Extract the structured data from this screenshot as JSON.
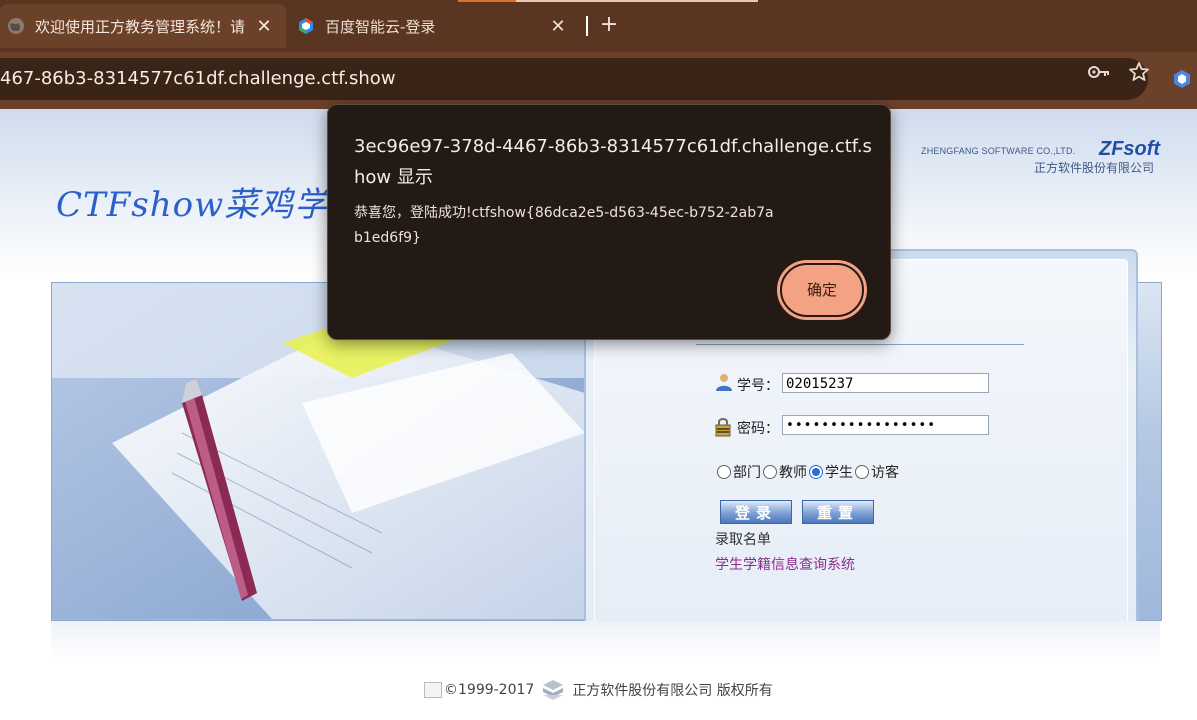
{
  "browser": {
    "tabs": [
      {
        "title": "欢迎使用正方教务管理系统！请",
        "icon": "globe-icon",
        "active": true
      },
      {
        "title": "百度智能云-登录",
        "icon": "baidu-cloud-icon",
        "active": false
      }
    ],
    "new_tab_label": "+",
    "close_label": "✕",
    "url": "467-86b3-8314577c61df.challenge.ctf.show"
  },
  "page": {
    "brand_en": "ZHENGFANG SOFTWARE CO.,LTD.",
    "brand_logo": "ZFsoft",
    "brand_cn": "正方软件股份有限公司",
    "site_logo": "CTFshow菜鸡学",
    "form": {
      "student_id_label": "学号：",
      "student_id_value": "02015237",
      "password_label": "密码：",
      "password_value": "•••••••••••••••••",
      "roles": [
        {
          "label": "部门",
          "checked": false
        },
        {
          "label": "教师",
          "checked": false
        },
        {
          "label": "学生",
          "checked": true
        },
        {
          "label": "访客",
          "checked": false
        }
      ],
      "login_button": "登录",
      "reset_button": "重置",
      "admission_link": "录取名单",
      "student_status_link": "学生学籍信息查询系统"
    },
    "footer": {
      "copyright": "©1999-2017",
      "company": "正方软件股份有限公司 版权所有"
    }
  },
  "dialog": {
    "title": "3ec96e97-378d-4467-86b3-8314577c61df.challenge.ctf.show 显示",
    "message": "恭喜您，登陆成功!ctfshow{86dca2e5-d563-45ec-b752-2ab7ab1ed6f9}",
    "ok_button": "确定"
  },
  "colors": {
    "tabbar": "#5a3622",
    "toolbar": "#6b412a",
    "dialog_bg": "#231a15",
    "dialog_button": "#f4a284",
    "link_purple": "#8e2c8c"
  }
}
